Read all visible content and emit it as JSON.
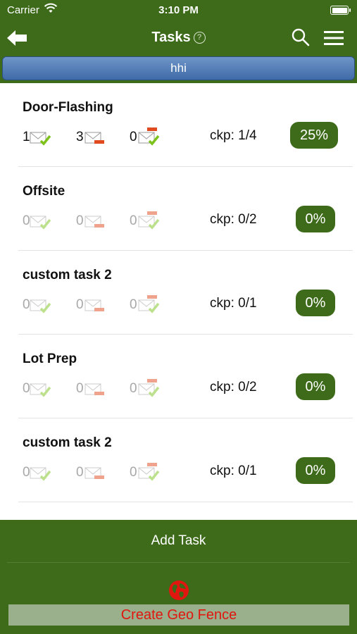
{
  "status": {
    "carrier": "Carrier",
    "time": "3:10 PM"
  },
  "nav": {
    "title": "Tasks",
    "help": "?"
  },
  "group": {
    "label": "hhi"
  },
  "icons": {
    "back": "arrow-left-icon",
    "search": "search-icon",
    "menu": "hamburger-menu-icon",
    "sent": "envelope-check-icon",
    "pending": "envelope-minus-icon",
    "approved": "envelope-flag-check-icon",
    "globe": "globe-icon"
  },
  "colors": {
    "brand_green": "#3d6b1a",
    "group_blue": "#4a76b0",
    "geo_red": "#e0160f"
  },
  "tasks": [
    {
      "name": "Door-Flashing",
      "sent": "1",
      "pending": "3",
      "approved": "0",
      "ckp": "ckp: 1/4",
      "pct": "25%",
      "active": true
    },
    {
      "name": "Offsite",
      "sent": "0",
      "pending": "0",
      "approved": "0",
      "ckp": "ckp: 0/2",
      "pct": "0%",
      "active": false
    },
    {
      "name": "custom task 2",
      "sent": "0",
      "pending": "0",
      "approved": "0",
      "ckp": "ckp: 0/1",
      "pct": "0%",
      "active": false
    },
    {
      "name": "Lot Prep",
      "sent": "0",
      "pending": "0",
      "approved": "0",
      "ckp": "ckp: 0/2",
      "pct": "0%",
      "active": false
    },
    {
      "name": "custom task 2",
      "sent": "0",
      "pending": "0",
      "approved": "0",
      "ckp": "ckp: 0/1",
      "pct": "0%",
      "active": false
    }
  ],
  "footer": {
    "add_task": "Add Task",
    "geo_fence": "Create Geo Fence"
  }
}
